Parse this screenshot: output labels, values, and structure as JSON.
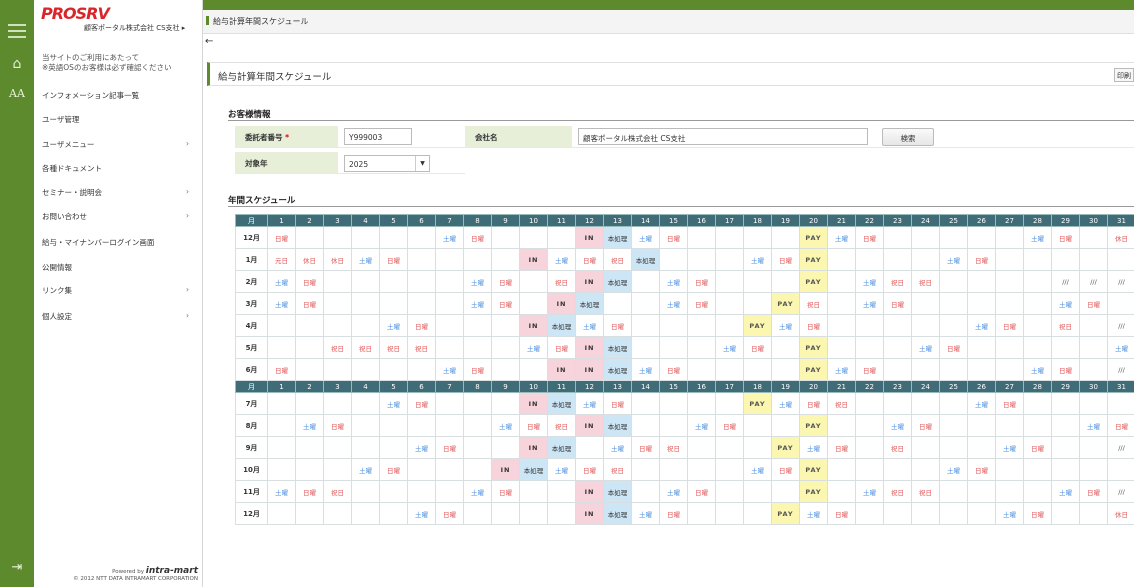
{
  "app": {
    "logo": "PROSRV",
    "company": "顧客ポータル株式会社 CS支社 ▸"
  },
  "breadcrumb": "給与計算年間スケジュール",
  "sidebar": {
    "notice": "当サイトのご利用にあたって\n※英語OSのお客様は必ず確認ください",
    "items": [
      {
        "label": "インフォメーション記事一覧",
        "chevron": false
      },
      {
        "label": "ユーザ管理",
        "chevron": false
      },
      {
        "label": "ユーザメニュー",
        "chevron": true
      },
      {
        "label": "各種ドキュメント",
        "chevron": false
      },
      {
        "label": "セミナー・説明会",
        "chevron": true
      },
      {
        "label": "お問い合わせ",
        "chevron": true
      },
      {
        "label": "給与・マイナンバーログイン画面",
        "chevron": false
      },
      {
        "label": "公開情報",
        "chevron": false
      },
      {
        "label": "リンク集",
        "chevron": true
      },
      {
        "label": "個人設定",
        "chevron": true
      }
    ],
    "footer_powered": "Powered by",
    "footer_brand": "intra-mart",
    "footer_copyright": "© 2012 NTT DATA INTRAMART CORPORATION"
  },
  "page": {
    "title": "給与計算年間スケジュール",
    "print_label": "印刷"
  },
  "customer": {
    "section_title": "お客様情報",
    "consignor_label": "委託者番号",
    "required_mark": "*",
    "consignor_value": "Y999003",
    "company_label": "会社名",
    "company_value": "顧客ポータル株式会社 CS支社",
    "search_button": "検索",
    "year_label": "対象年",
    "year_value": "2025"
  },
  "schedule": {
    "section_title": "年間スケジュール",
    "header_month": "月",
    "days": [
      "1",
      "2",
      "3",
      "4",
      "5",
      "6",
      "7",
      "8",
      "9",
      "10",
      "11",
      "12",
      "13",
      "14",
      "15",
      "16",
      "17",
      "18",
      "19",
      "20",
      "21",
      "22",
      "23",
      "24",
      "25",
      "26",
      "27",
      "28",
      "29",
      "30",
      "31"
    ],
    "rows": [
      {
        "month": "12月",
        "cells": {
          "1": "日曜",
          "7": "土曜",
          "8": "日曜",
          "12": "IN",
          "13": "本処理",
          "14": "土曜",
          "15": "日曜",
          "20": "PAY",
          "21": "土曜",
          "22": "日曜",
          "28": "土曜",
          "29": "日曜",
          "31": "休日"
        }
      },
      {
        "month": "1月",
        "cells": {
          "1": "元日",
          "2": "休日",
          "3": "休日",
          "4": "土曜",
          "5": "日曜",
          "10": "IN",
          "11": "土曜",
          "12": "日曜",
          "13": "祝日",
          "14": "本処理",
          "18": "土曜",
          "19": "日曜",
          "20": "PAY",
          "25": "土曜",
          "26": "日曜"
        }
      },
      {
        "month": "2月",
        "cells": {
          "1": "土曜",
          "2": "日曜",
          "8": "土曜",
          "9": "日曜",
          "11": "祝日",
          "12": "IN",
          "13": "本処理",
          "15": "土曜",
          "16": "日曜",
          "20": "PAY",
          "22": "土曜",
          "23": "祝日",
          "24": "祝日",
          "29": "///",
          "30": "///",
          "31": "///"
        }
      },
      {
        "month": "3月",
        "cells": {
          "1": "土曜",
          "2": "日曜",
          "8": "土曜",
          "9": "日曜",
          "11": "IN",
          "12": "本処理",
          "15": "土曜",
          "16": "日曜",
          "19": "PAY",
          "20": "祝日",
          "22": "土曜",
          "23": "日曜",
          "29": "土曜",
          "30": "日曜"
        }
      },
      {
        "month": "4月",
        "cells": {
          "5": "土曜",
          "6": "日曜",
          "10": "IN",
          "11": "本処理",
          "12": "土曜",
          "13": "日曜",
          "18": "PAY",
          "19": "土曜",
          "20": "日曜",
          "26": "土曜",
          "27": "日曜",
          "29": "祝日",
          "31": "///"
        }
      },
      {
        "month": "5月",
        "cells": {
          "3": "祝日",
          "4": "祝日",
          "5": "祝日",
          "6": "祝日",
          "10": "土曜",
          "11": "日曜",
          "12": "IN",
          "13": "本処理",
          "17": "土曜",
          "18": "日曜",
          "20": "PAY",
          "24": "土曜",
          "25": "日曜",
          "31": "土曜"
        }
      },
      {
        "month": "6月",
        "cells": {
          "1": "日曜",
          "7": "土曜",
          "8": "日曜",
          "11": "IN",
          "12": "IN",
          "13": "本処理",
          "14": "土曜",
          "15": "日曜",
          "20": "PAY",
          "21": "土曜",
          "22": "日曜",
          "28": "土曜",
          "29": "日曜",
          "31": "///"
        }
      },
      {
        "header": true
      },
      {
        "month": "7月",
        "cells": {
          "5": "土曜",
          "6": "日曜",
          "10": "IN",
          "11": "本処理",
          "12": "土曜",
          "13": "日曜",
          "18": "PAY",
          "19": "土曜",
          "20": "日曜",
          "21": "祝日",
          "26": "土曜",
          "27": "日曜"
        }
      },
      {
        "month": "8月",
        "cells": {
          "2": "土曜",
          "3": "日曜",
          "9": "土曜",
          "10": "日曜",
          "11": "祝日",
          "12": "IN",
          "13": "本処理",
          "16": "土曜",
          "17": "日曜",
          "20": "PAY",
          "23": "土曜",
          "24": "日曜",
          "30": "土曜",
          "31": "日曜"
        }
      },
      {
        "month": "9月",
        "cells": {
          "6": "土曜",
          "7": "日曜",
          "10": "IN",
          "11": "本処理",
          "13": "土曜",
          "14": "日曜",
          "15": "祝日",
          "19": "PAY",
          "20": "土曜",
          "21": "日曜",
          "23": "祝日",
          "27": "土曜",
          "28": "日曜",
          "31": "///"
        }
      },
      {
        "month": "10月",
        "cells": {
          "4": "土曜",
          "5": "日曜",
          "9": "IN",
          "10": "本処理",
          "11": "土曜",
          "12": "日曜",
          "13": "祝日",
          "18": "土曜",
          "19": "日曜",
          "20": "PAY",
          "25": "土曜",
          "26": "日曜"
        }
      },
      {
        "month": "11月",
        "cells": {
          "1": "土曜",
          "2": "日曜",
          "3": "祝日",
          "8": "土曜",
          "9": "日曜",
          "12": "IN",
          "13": "本処理",
          "15": "土曜",
          "16": "日曜",
          "20": "PAY",
          "22": "土曜",
          "23": "祝日",
          "24": "祝日",
          "29": "土曜",
          "30": "日曜",
          "31": "///"
        }
      },
      {
        "month": "12月",
        "cells": {
          "6": "土曜",
          "7": "日曜",
          "12": "IN",
          "13": "本処理",
          "14": "土曜",
          "15": "日曜",
          "19": "PAY",
          "20": "土曜",
          "21": "日曜",
          "27": "土曜",
          "28": "日曜",
          "31": "休日"
        }
      }
    ]
  },
  "colors": {
    "brand": "#5e8a2e",
    "header": "#3f6c77",
    "in": "#f7d4dc",
    "process": "#cde6f6",
    "pay": "#fbf7b0"
  }
}
